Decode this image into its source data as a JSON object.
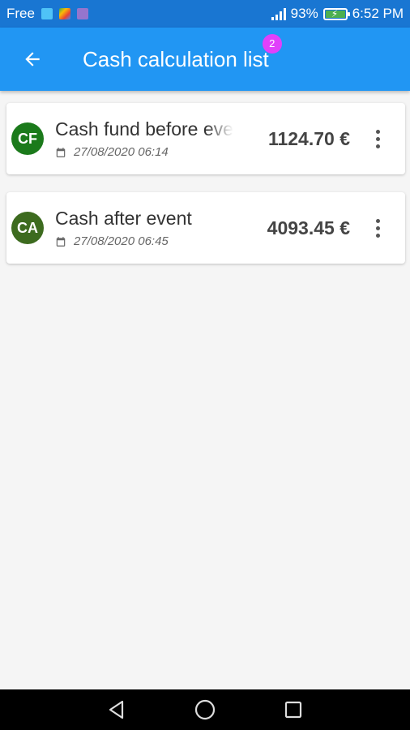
{
  "status_bar": {
    "carrier": "Free",
    "battery_percent": "93%",
    "time": "6:52 PM",
    "icons": [
      "sim-icon",
      "play-store-icon",
      "app-icon",
      "signal-icon",
      "battery-charging-icon"
    ]
  },
  "app_bar": {
    "title": "Cash calculation list",
    "badge_count": "2",
    "back_icon": "arrow-back-icon"
  },
  "items": [
    {
      "initials": "CF",
      "title": "Cash fund before event",
      "date": "27/08/2020 06:14",
      "amount": "1124.70 €",
      "avatar_color": "#1b7a1b"
    },
    {
      "initials": "CA",
      "title": "Cash after event",
      "date": "27/08/2020 06:45",
      "amount": "4093.45 €",
      "avatar_color": "#3d6b1f"
    }
  ],
  "nav_bar": {
    "icons": [
      "back-triangle-icon",
      "home-circle-icon",
      "recents-square-icon"
    ]
  },
  "colors": {
    "status_bar": "#1976d2",
    "app_bar": "#2196f3",
    "badge": "#e040fb",
    "background": "#f5f5f5"
  }
}
